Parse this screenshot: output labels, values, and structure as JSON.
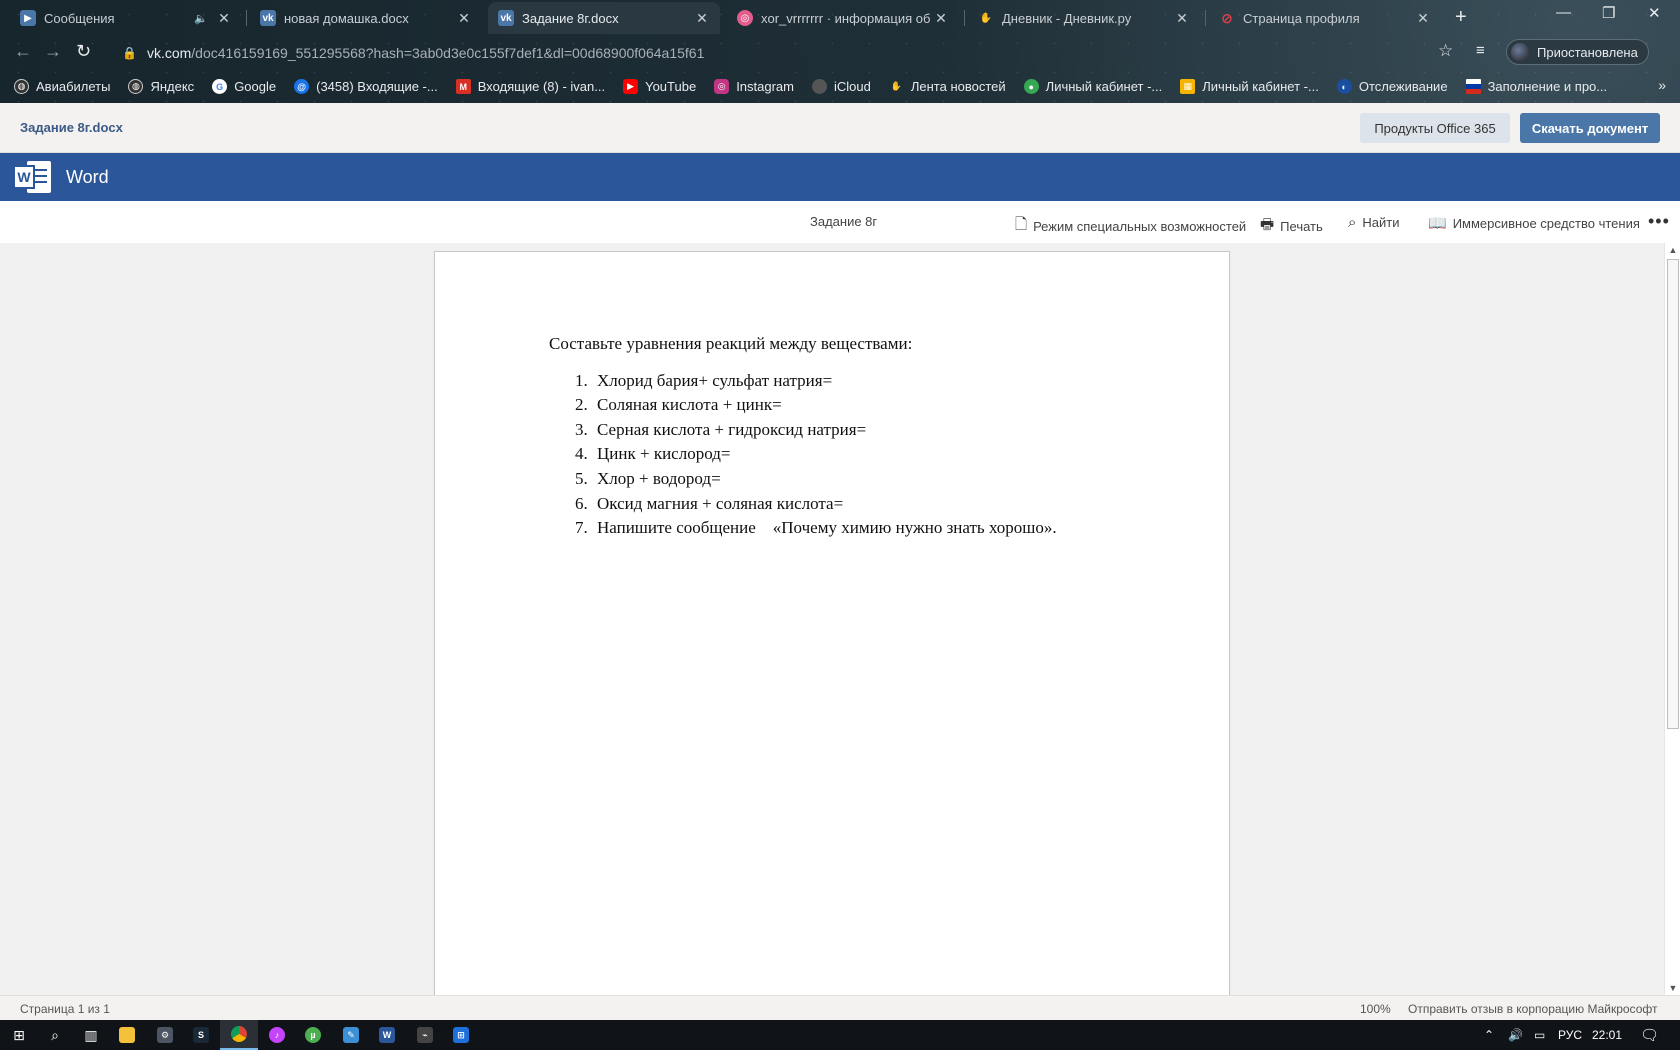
{
  "browser": {
    "tabs": [
      {
        "title": "Сообщения",
        "active": false,
        "audio": true
      },
      {
        "title": "новая домашка.docx",
        "active": false
      },
      {
        "title": "Задание 8г.docx",
        "active": true
      },
      {
        "title": "xor_vrrrrrrr · информация об и",
        "active": false
      },
      {
        "title": "Дневник - Дневник.ру",
        "active": false
      },
      {
        "title": "Страница профиля",
        "active": false
      }
    ],
    "new_tab": "+",
    "url_host": "vk.com",
    "url_path": "/doc416159169_551295568?hash=3ab0d3e0c155f7def1&dl=00d68900f064a15f61",
    "profile_label": "Приостановлена",
    "bookmarks": [
      {
        "label": "Авиабилеты"
      },
      {
        "label": "Яндекс"
      },
      {
        "label": "Google"
      },
      {
        "label": "(3458) Входящие -..."
      },
      {
        "label": "Входящие (8) - ivan..."
      },
      {
        "label": "YouTube"
      },
      {
        "label": "Instagram"
      },
      {
        "label": "iCloud"
      },
      {
        "label": "Лента новостей"
      },
      {
        "label": "Личный кабинет -..."
      },
      {
        "label": "Личный кабинет -..."
      },
      {
        "label": "Отслеживание"
      },
      {
        "label": "Заполнение и про..."
      }
    ]
  },
  "viewer": {
    "doc_filename": "Задание 8г.docx",
    "office_button": "Продукты Office 365",
    "download_button": "Скачать документ",
    "app_name": "Word",
    "doc_title": "Задание 8г",
    "commands": {
      "accessibility": "Режим специальных возможностей",
      "print": "Печать",
      "find": "Найти",
      "immersive": "Иммерсивное средство чтения"
    }
  },
  "document": {
    "lead": "Составьте  уравнения реакций  между веществами:",
    "items": [
      {
        "num": "1.",
        "text": "Хлорид бария+ сульфат натрия="
      },
      {
        "num": "2.",
        "text": "Соляная кислота + цинк="
      },
      {
        "num": "3.",
        "text": "Серная кислота + гидроксид натрия="
      },
      {
        "num": "4.",
        "text": "Цинк + кислород="
      },
      {
        "num": "5.",
        "text": "Хлор + водород="
      },
      {
        "num": "6.",
        "text": "Оксид магния + соляная кислота="
      },
      {
        "num": "7.",
        "text": "Напишите сообщение    «Почему химию нужно знать хорошо»."
      }
    ]
  },
  "status": {
    "page": "Страница 1 из 1",
    "zoom": "100%",
    "feedback": "Отправить отзыв в корпорацию Майкрософт"
  },
  "taskbar": {
    "language": "РУС",
    "time": "22:01"
  }
}
